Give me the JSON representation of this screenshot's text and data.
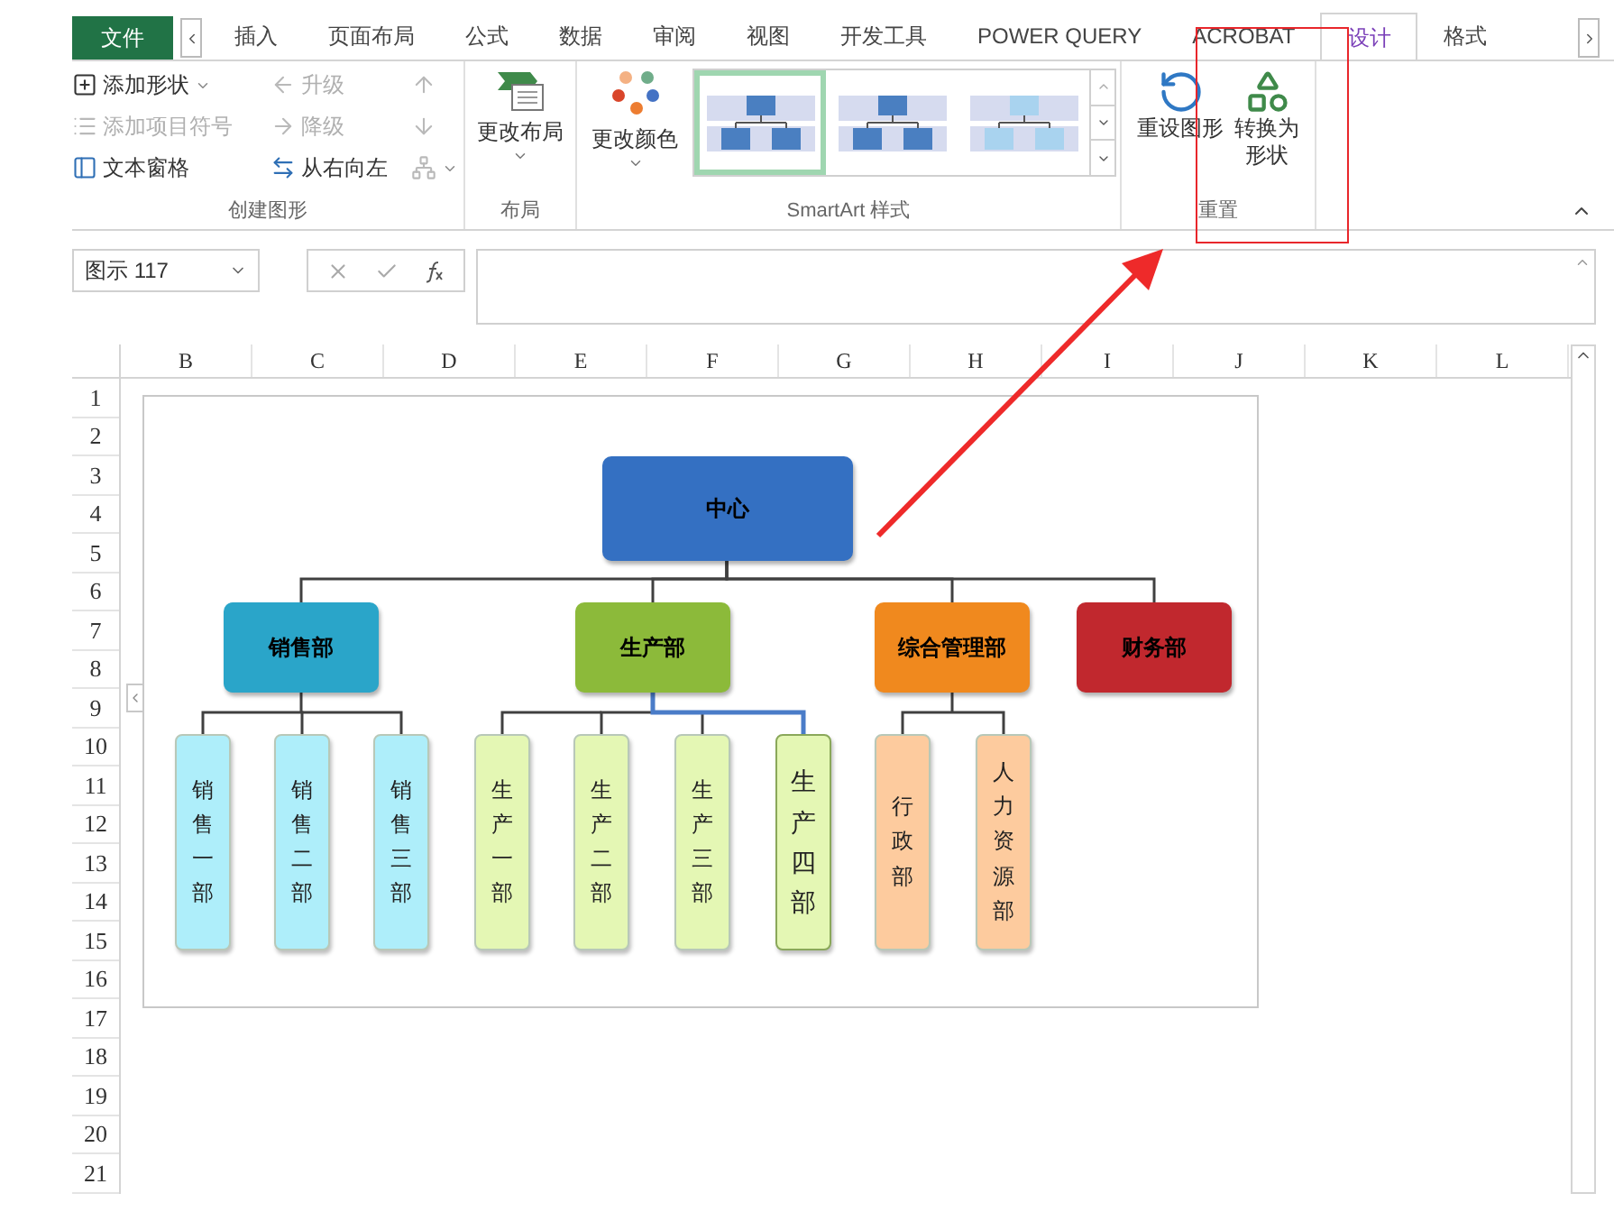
{
  "tabs": [
    {
      "label": "文件",
      "kind": "file",
      "selected": false
    },
    {
      "label": "插入",
      "kind": "tab",
      "selected": false
    },
    {
      "label": "页面布局",
      "kind": "tab",
      "selected": false
    },
    {
      "label": "公式",
      "kind": "tab",
      "selected": false
    },
    {
      "label": "数据",
      "kind": "tab",
      "selected": false
    },
    {
      "label": "审阅",
      "kind": "tab",
      "selected": false
    },
    {
      "label": "视图",
      "kind": "tab",
      "selected": false
    },
    {
      "label": "开发工具",
      "kind": "tab",
      "selected": false
    },
    {
      "label": "POWER QUERY",
      "kind": "tab",
      "selected": false
    },
    {
      "label": "ACROBAT",
      "kind": "tab",
      "selected": false
    },
    {
      "label": "设计",
      "kind": "tab",
      "selected": true
    },
    {
      "label": "格式",
      "kind": "tab",
      "selected": false
    }
  ],
  "create_group": {
    "caption": "创建图形",
    "items": [
      {
        "kind": "add-shape",
        "label": "添加形状",
        "disabled": false,
        "dropdown": true
      },
      {
        "kind": "promote",
        "label": "升级",
        "disabled": true,
        "dropdown": false
      },
      {
        "kind": "move-up",
        "disabled": true,
        "dropdown": false
      },
      {
        "kind": "add-bullet",
        "label": "添加项目符号",
        "disabled": true,
        "dropdown": false
      },
      {
        "kind": "demote",
        "label": "降级",
        "disabled": true,
        "dropdown": false
      },
      {
        "kind": "move-down",
        "disabled": true,
        "dropdown": false
      },
      {
        "kind": "text-pane",
        "label": "文本窗格",
        "disabled": false,
        "dropdown": false
      },
      {
        "kind": "right-to-left",
        "label": "从右向左",
        "disabled": false,
        "dropdown": false
      },
      {
        "kind": "layout",
        "disabled": true,
        "dropdown": true
      }
    ]
  },
  "layout_group": {
    "caption": "布局",
    "button": "更改布局"
  },
  "styles_group": {
    "caption": "SmartArt 样式",
    "color_button": "更改颜色",
    "thumbnails": [
      {
        "selected": true
      },
      {
        "selected": false
      },
      {
        "selected": false
      }
    ]
  },
  "reset_group": {
    "caption": "重置",
    "buttons": [
      {
        "kind": "reset",
        "label": "重设图形"
      },
      {
        "kind": "convert",
        "label": "转换为形状"
      }
    ]
  },
  "formula_bar": {
    "name_box": "图示 117"
  },
  "columns": [
    "B",
    "C",
    "D",
    "E",
    "F",
    "G",
    "H",
    "I",
    "J",
    "K",
    "L"
  ],
  "rows": [
    "1",
    "2",
    "3",
    "4",
    "5",
    "6",
    "7",
    "8",
    "9",
    "10",
    "11",
    "12",
    "13",
    "14",
    "15",
    "16",
    "17",
    "18",
    "19",
    "20",
    "21"
  ],
  "smartart": {
    "root": {
      "text": "中心",
      "color": "#3470c2",
      "children": [
        {
          "text": "销售部",
          "color": "#2aa5c9",
          "children": [
            {
              "text": "销售一部",
              "color": "#aeeefa",
              "selected": false
            },
            {
              "text": "销售二部",
              "color": "#aeeefa",
              "selected": false
            },
            {
              "text": "销售三部",
              "color": "#aeeefa",
              "selected": false
            }
          ]
        },
        {
          "text": "生产部",
          "color": "#8cba3a",
          "children": [
            {
              "text": "生产一部",
              "color": "#e4f7b4",
              "selected": false
            },
            {
              "text": "生产二部",
              "color": "#e4f7b4",
              "selected": false
            },
            {
              "text": "生产三部",
              "color": "#e4f7b4",
              "selected": false
            },
            {
              "text": "生产四部",
              "color": "#e4f7b4",
              "selected": true
            }
          ]
        },
        {
          "text": "综合管理部",
          "color": "#f0891e",
          "children": [
            {
              "text": "行政部",
              "color": "#fdcb9e",
              "selected": false
            },
            {
              "text": "人力资源部",
              "color": "#fdcb9e",
              "selected": false
            }
          ]
        },
        {
          "text": "财务部",
          "color": "#c1282e"
        }
      ]
    }
  }
}
